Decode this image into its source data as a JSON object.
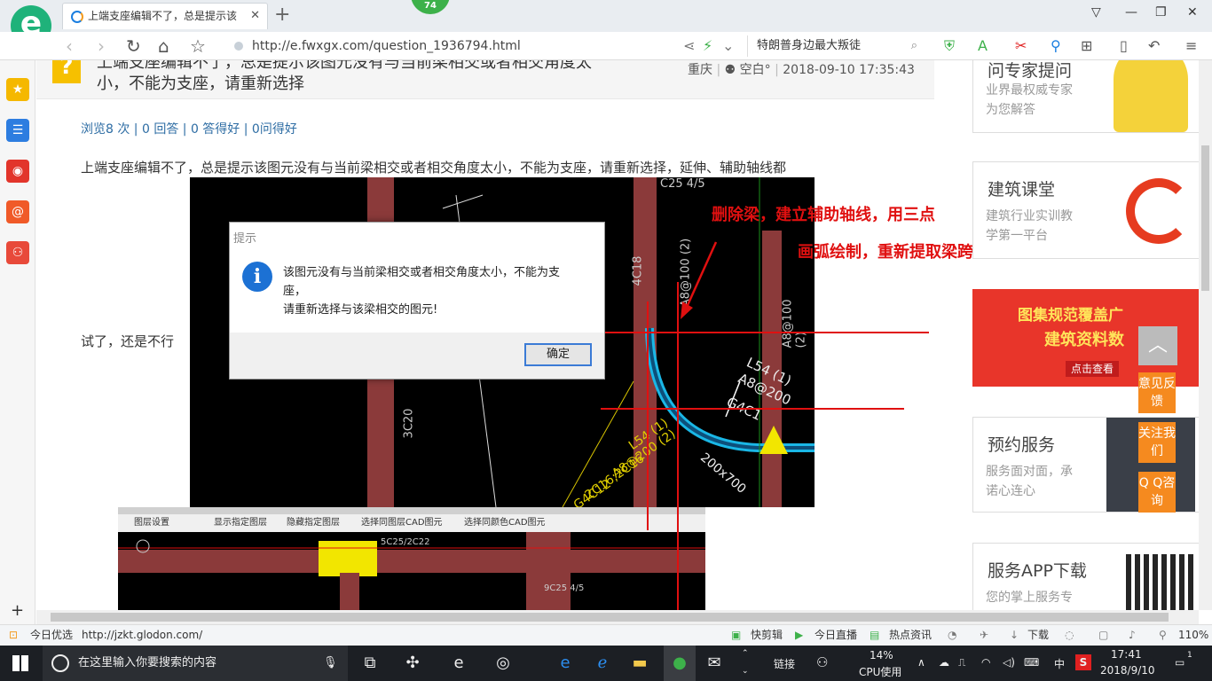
{
  "browser": {
    "tab_title": "上端支座编辑不了，总是提示该",
    "tab_close": "✕",
    "newtab": "+",
    "badge": "74",
    "url": "http://e.fwxgx.com/question_1936794.html",
    "hot_search": "特朗普身边最大叛徒"
  },
  "question": {
    "title_line1": "上端支座编辑不了，总是提示该图元没有与当前梁相交或者相交角度太",
    "title_line2": "小，不能为支座，请重新选择",
    "location": "重庆",
    "user": "空白°",
    "datetime": "2018-09-10 17:35:43",
    "stats": "浏览8 次 | 0 回答 | 0 答得好 | 0问得好",
    "body1": "上端支座编辑不了，总是提示该图元没有与当前梁相交或者相交角度太小，不能为支座，请重新选择，延伸、辅助轴线都",
    "body2": "试了，还是不行"
  },
  "dialog": {
    "header": "提示",
    "icon": "i",
    "msg1": "该图元没有与当前梁相交或者相交角度太小，不能为支",
    "msg2": "座，",
    "msg3": "请重新选择与该梁相交的图元!",
    "ok": "确定"
  },
  "annotation": {
    "line1": "删除梁，建立辅助轴线，用三点",
    "line2": "画弧绘制，重新提取梁跨"
  },
  "cad": {
    "labels": [
      "4C18",
      "A8@100 (2)",
      "A8@100 (2)",
      "3C20",
      "C25 4/5",
      "L54 (1)",
      "A8@200",
      "G4C1",
      "L54 (1)",
      "A8@200 (2)",
      "2C16;2C16",
      "G4C12",
      "200x700"
    ],
    "toolbar": [
      "图层设置",
      "显示指定图层",
      "隐藏指定图层",
      "选择同图层CAD图元",
      "选择同颜色CAD图元"
    ],
    "lower_labels": [
      "5C25/2C22",
      "9C25 4/5"
    ]
  },
  "ads": [
    {
      "title": "问专家提问",
      "sub1": "业界最权威专家",
      "sub2": "为您解答"
    },
    {
      "title": "建筑课堂",
      "sub1": "建筑行业实训教",
      "sub2": "学第一平台"
    },
    {
      "title": "图集规范覆盖广",
      "sub1": "建筑资料数",
      "sub2": "点击查看"
    },
    {
      "title": "预约服务",
      "sub1": "服务面对面，承",
      "sub2": "诺心连心"
    },
    {
      "title": "服务APP下载",
      "sub1": "您的掌上服务专",
      "sub2": ""
    }
  ],
  "float_buttons": {
    "up": "︿",
    "feedback": "意见反馈",
    "follow": "关注我们",
    "qq": "Q Q咨询"
  },
  "status": {
    "left1": "今日优选",
    "url": "http://jzkt.glodon.com/",
    "r1": "快剪辑",
    "r2": "今日直播",
    "r3": "热点资讯",
    "r4": "下载",
    "zoom": "110%"
  },
  "taskbar": {
    "search_placeholder": "在这里输入你要搜索的内容",
    "link": "链接",
    "cpu_pct": "14%",
    "cpu_label": "CPU使用",
    "ime": "中",
    "time": "17:41",
    "date": "2018/9/10",
    "notif": "1"
  }
}
